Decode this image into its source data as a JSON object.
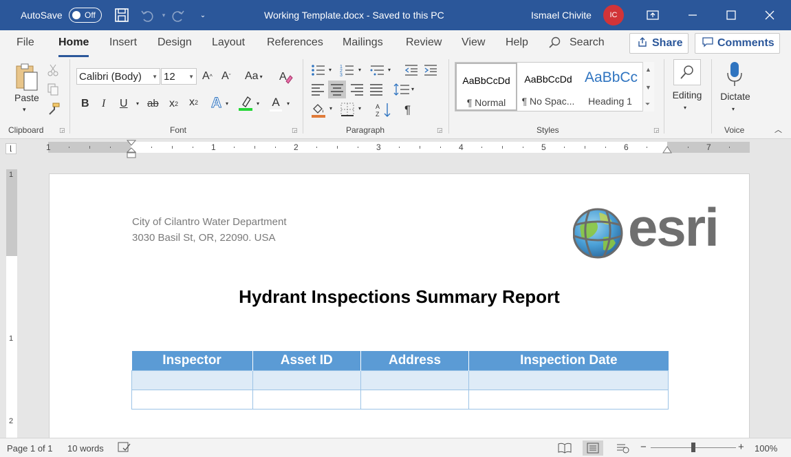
{
  "titlebar": {
    "autosave_label": "AutoSave",
    "autosave_state": "Off",
    "document_title": "Working Template.docx  -  Saved to this PC",
    "user_name": "Ismael Chivite",
    "user_initials": "IC",
    "icons": [
      "save-icon",
      "undo-icon",
      "redo-icon",
      "customize-toolbar-icon",
      "ribbon-display-options-icon",
      "minimize-icon",
      "maximize-icon",
      "close-icon"
    ]
  },
  "menu": {
    "tabs": [
      "File",
      "Home",
      "Insert",
      "Design",
      "Layout",
      "References",
      "Mailings",
      "Review",
      "View",
      "Help"
    ],
    "active": "Home",
    "search": "Search",
    "share": "Share",
    "comments": "Comments"
  },
  "ribbon": {
    "clipboard": {
      "paste": "Paste",
      "label": "Clipboard"
    },
    "font": {
      "name": "Calibri (Body)",
      "size": "12",
      "label": "Font",
      "bold": "B",
      "italic": "I",
      "underline": "U",
      "strike": "ab",
      "subscript": "x",
      "superscript": "x",
      "text_effects": "A",
      "font_color": "A",
      "grow": "A",
      "shrink": "A",
      "change_case": "Aa"
    },
    "paragraph": {
      "label": "Paragraph",
      "pilcrow": "¶"
    },
    "styles": {
      "label": "Styles",
      "items": [
        {
          "sample": "AaBbCcDd",
          "name": "¶ Normal"
        },
        {
          "sample": "AaBbCcDd",
          "name": "¶ No Spac..."
        },
        {
          "sample": "AaBbCc",
          "name": "Heading 1"
        }
      ]
    },
    "editing": {
      "label": "Editing"
    },
    "voice": {
      "dictate": "Dictate",
      "label": "Voice"
    }
  },
  "ruler": {
    "h_numbers": [
      "1",
      "1",
      "2",
      "3",
      "4",
      "5",
      "6",
      "7"
    ],
    "v_numbers": [
      "1",
      "1",
      "2"
    ]
  },
  "document": {
    "address_line1": "City of Cilantro Water Department",
    "address_line2": "3030 Basil St, OR, 22090. USA",
    "logo_text": "esri",
    "title": "Hydrant Inspections Summary Report",
    "table_headers": [
      "Inspector",
      "Asset ID",
      "Address",
      "Inspection Date"
    ],
    "table_rows": [
      [
        "",
        "",
        "",
        ""
      ],
      [
        "",
        "",
        "",
        ""
      ]
    ]
  },
  "statusbar": {
    "page": "Page 1 of 1",
    "words": "10 words",
    "zoom": "100%",
    "zoom_minus": "−",
    "zoom_plus": "+"
  },
  "colors": {
    "brand": "#2b579a",
    "table_header": "#5b9bd5",
    "table_band": "#deebf7",
    "avatar": "#d13438"
  }
}
